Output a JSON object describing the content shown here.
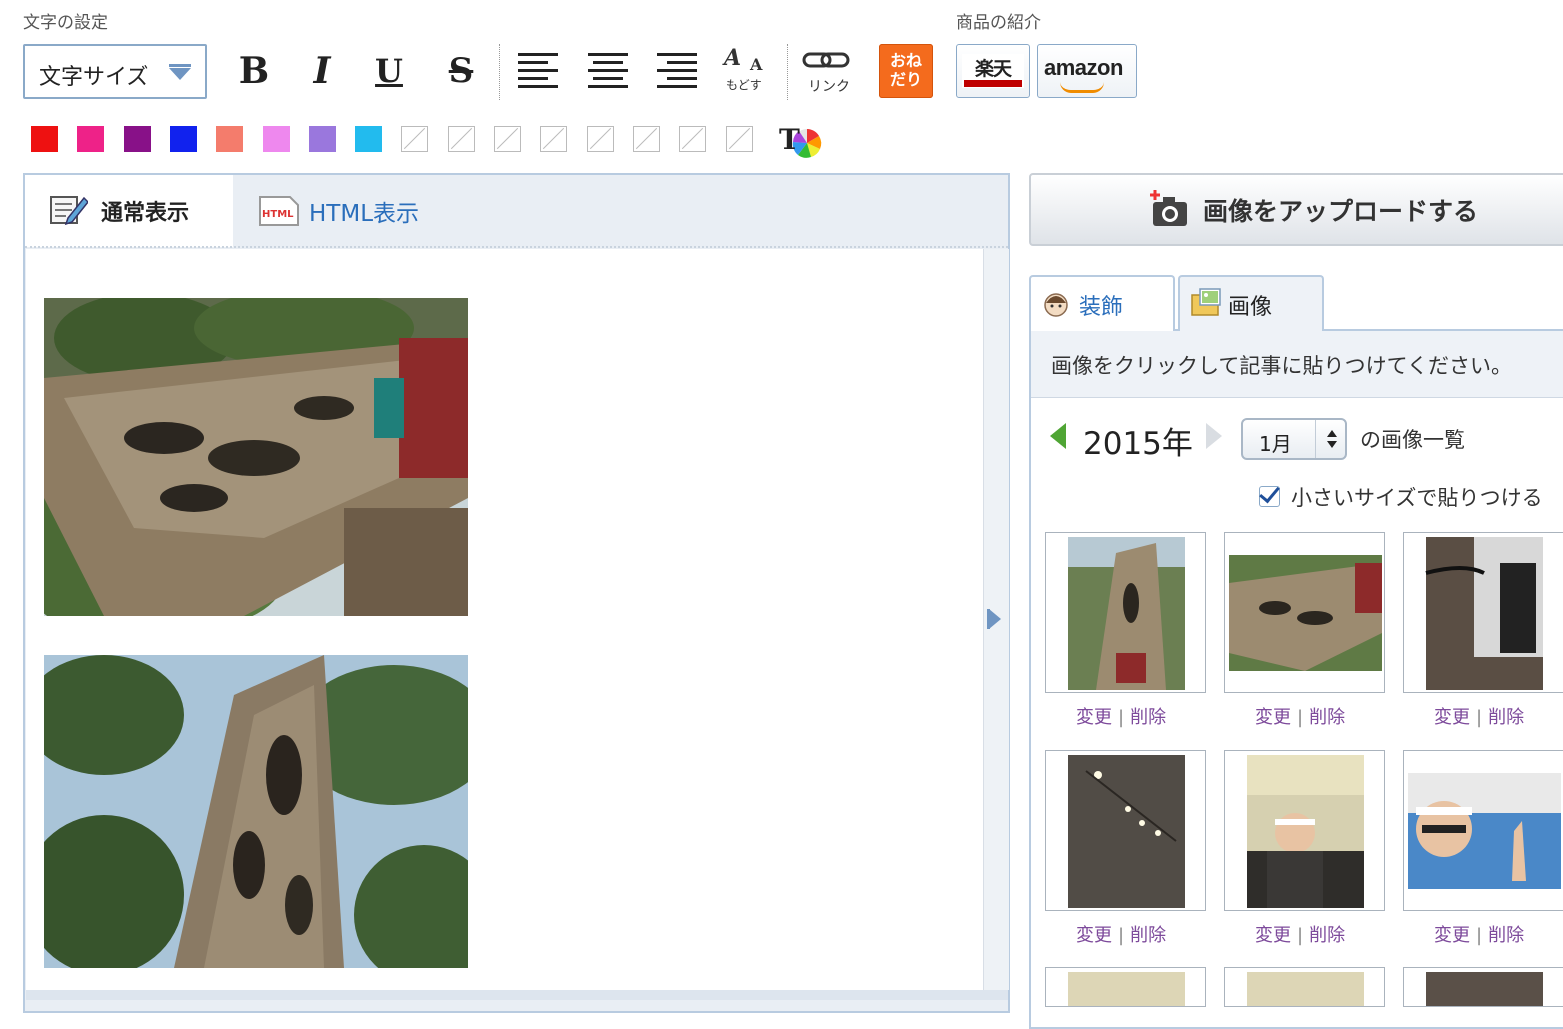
{
  "toolbar": {
    "text_settings_label": "文字の設定",
    "product_intro_label": "商品の紹介",
    "font_size_select": "文字サイズ",
    "bold": "B",
    "italic": "I",
    "underline": "U",
    "strike": "S",
    "undo_caption": "もどす",
    "link_caption": "リンク",
    "onedari": "おね\nだり",
    "rakuten": "楽天",
    "amazon": "amazon"
  },
  "colors": {
    "swatches": [
      "#ee1111",
      "#ee2288",
      "#881188",
      "#1122ee",
      "#f47c6c",
      "#ee88ee",
      "#9a77dd",
      "#22bbee"
    ],
    "empty_count": 8
  },
  "editor": {
    "tab_normal": "通常表示",
    "tab_html": "HTML表示"
  },
  "upload": {
    "label": "画像をアップロードする"
  },
  "side_tabs": {
    "decoration": "装飾",
    "image": "画像"
  },
  "panel": {
    "instruction": "画像をクリックして記事に貼りつけてください。",
    "year": "2015年",
    "month": "1月",
    "list_label": "の画像一覧",
    "small_size_label": "小さいサイズで貼りつける"
  },
  "thumb_actions": {
    "change": "変更",
    "delete": "削除"
  }
}
